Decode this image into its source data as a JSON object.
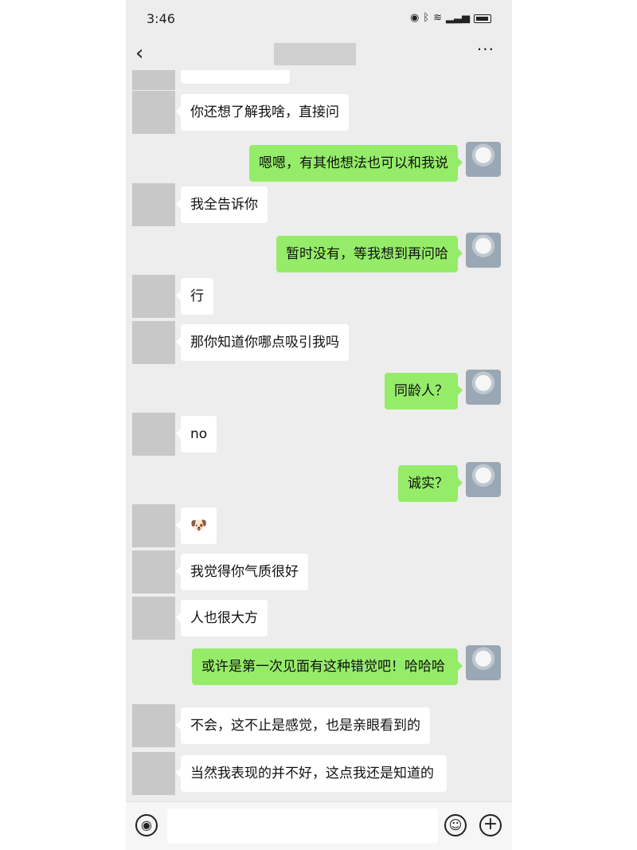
{
  "status": {
    "time": "3:46",
    "icons": [
      "eye-icon",
      "bluetooth-icon",
      "wifi-icon",
      "signal-icon",
      "battery-icon"
    ]
  },
  "nav": {
    "back_icon": "‹",
    "more_icon": "···"
  },
  "messages": [
    {
      "side": "in",
      "text": "你还想了解我啥，直接问"
    },
    {
      "side": "out",
      "text": "嗯嗯，有其他想法也可以和我说"
    },
    {
      "side": "in",
      "text": "我全告诉你"
    },
    {
      "side": "out",
      "text": "暂时没有，等我想到再问哈"
    },
    {
      "side": "in",
      "text": "行"
    },
    {
      "side": "in",
      "text": "那你知道你哪点吸引我吗"
    },
    {
      "side": "out",
      "text": "同龄人？"
    },
    {
      "side": "in",
      "text": "no"
    },
    {
      "side": "out",
      "text": "诚实？"
    },
    {
      "side": "in",
      "text": "🐶"
    },
    {
      "side": "in",
      "text": "我觉得你气质很好"
    },
    {
      "side": "in",
      "text": "人也很大方"
    },
    {
      "side": "out",
      "text": "或许是第一次见面有这种错觉吧！哈哈哈"
    },
    {
      "side": "in",
      "text": "不会，这不止是感觉，也是亲眼看到的"
    },
    {
      "side": "in",
      "text": "当然我表现的并不好，这点我还是知道的"
    }
  ],
  "input": {
    "voice_icon": "◉",
    "emoji_icon": "☺",
    "plus_icon": "+"
  },
  "colors": {
    "chat_bg": "#ededed",
    "outgoing_bubble": "#95ec69",
    "incoming_bubble": "#ffffff"
  }
}
